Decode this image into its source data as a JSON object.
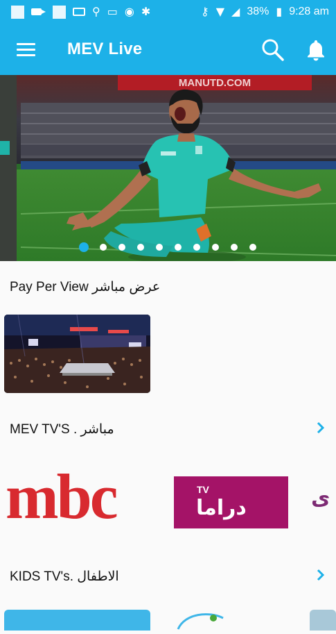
{
  "status_bar": {
    "icons": [
      "notification-square-icon",
      "video-icon",
      "notification-square-icon",
      "keyboard-icon",
      "usb-icon",
      "cast-icon",
      "vpn-icon",
      "android-icon",
      "key-icon",
      "wifi-icon",
      "no-signal-icon",
      "battery-icon"
    ],
    "battery": "38%",
    "time": "9:28 am"
  },
  "app_bar": {
    "title": "MEV Live",
    "menu_icon": "hamburger-menu-icon",
    "search_icon": "search-icon",
    "notifications_icon": "bell-icon"
  },
  "hero": {
    "banner_text": "MANUTD.COM",
    "slide_count": 10,
    "active_slide": 1
  },
  "sections": {
    "ppv": {
      "title": "Pay Per View عرض مباشر"
    },
    "mev_tvs": {
      "title": "MEV TV'S . مباشر"
    },
    "kids_tvs": {
      "title": "KIDS TV's. الاطفال"
    }
  },
  "channels": [
    {
      "name": "mbc",
      "text": "mbc",
      "color": "#d82a2f"
    },
    {
      "name": "drama",
      "badge": "TV",
      "text": "دراما",
      "color": "#a41367"
    },
    {
      "name": "partial-channel",
      "text": "ى",
      "color": "#7d2b74"
    }
  ],
  "colors": {
    "primary": "#1db1e8",
    "background": "#fafafa"
  }
}
